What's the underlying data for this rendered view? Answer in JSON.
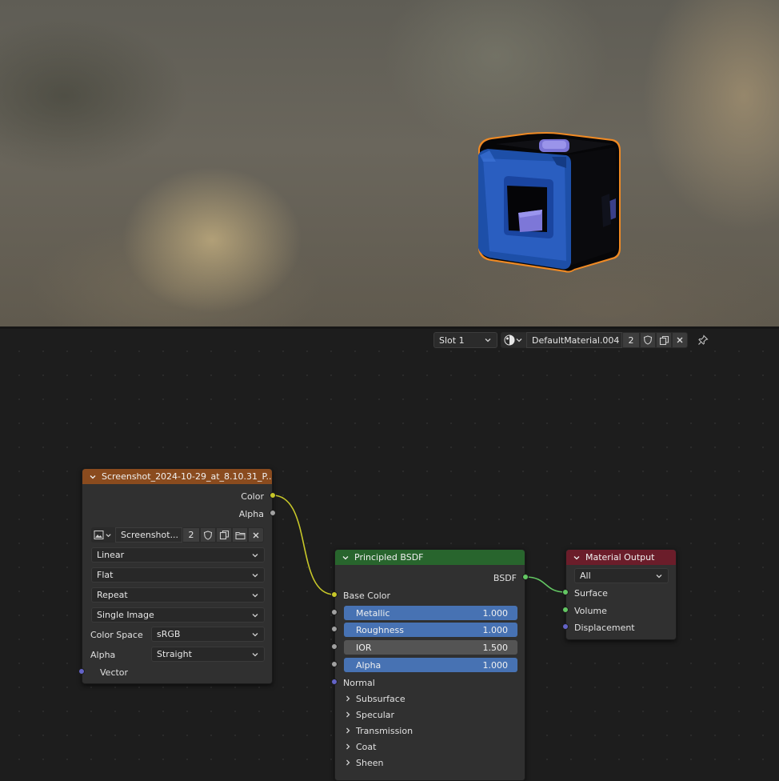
{
  "viewport": {
    "object_icon": "cube-object-icon"
  },
  "header": {
    "slot_label": "Slot 1",
    "material_name": "DefaultMaterial.004",
    "user_count": "2",
    "icons": [
      "material-sphere-icon",
      "shield-icon",
      "duplicate-icon",
      "close-icon",
      "pin-icon"
    ]
  },
  "image_node": {
    "title": "Screenshot_2024-10-29_at_8.10.31_P...",
    "header_color": "#8a4b1e",
    "outputs": [
      "Color",
      "Alpha"
    ],
    "image_name": "Screenshot...",
    "image_users": "2",
    "interpolation": "Linear",
    "projection": "Flat",
    "extension": "Repeat",
    "source": "Single Image",
    "color_space_label": "Color Space",
    "color_space_value": "sRGB",
    "alpha_label": "Alpha",
    "alpha_value": "Straight",
    "input_vector": "Vector"
  },
  "bsdf_node": {
    "title": "Principled BSDF",
    "header_color": "#28652d",
    "output": "BSDF",
    "base_color": "Base Color",
    "metallic_label": "Metallic",
    "metallic_value": "1.000",
    "roughness_label": "Roughness",
    "roughness_value": "1.000",
    "ior_label": "IOR",
    "ior_value": "1.500",
    "alpha_label": "Alpha",
    "alpha_value": "1.000",
    "normal": "Normal",
    "panels": [
      "Subsurface",
      "Specular",
      "Transmission",
      "Coat",
      "Sheen"
    ]
  },
  "output_node": {
    "title": "Material Output",
    "header_color": "#6b1d2a",
    "target": "All",
    "inputs": [
      "Surface",
      "Volume",
      "Displacement"
    ]
  },
  "colors": {
    "accent_blue": "#4772b3",
    "socket_color": "#c7c729",
    "socket_float": "#a1a1a1",
    "socket_vector": "#6363c7",
    "socket_shader": "#63c763",
    "selection_outline": "#f08a24"
  }
}
